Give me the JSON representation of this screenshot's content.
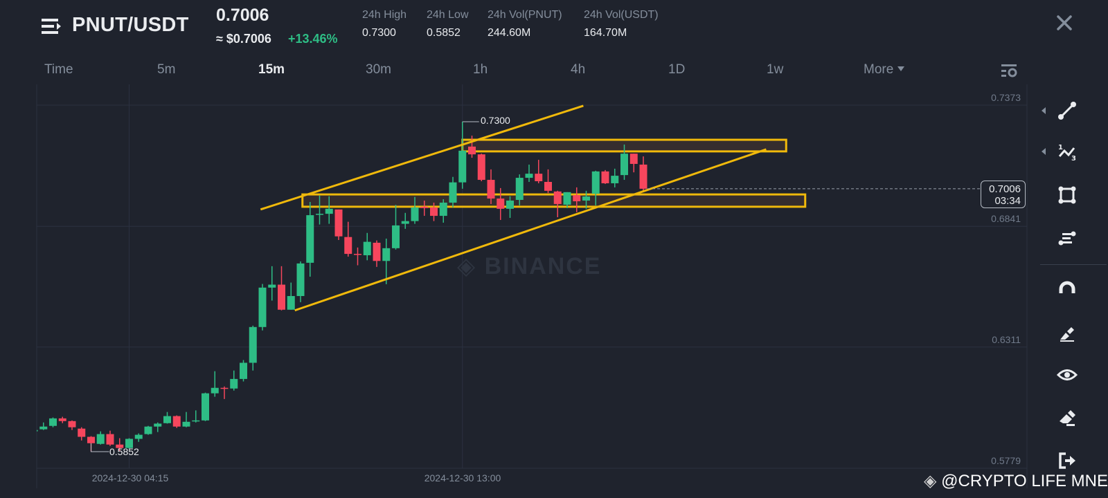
{
  "header": {
    "pair": "PNUT/USDT",
    "last_price": "0.7006",
    "approx_usd": "≈ $0.7006",
    "change_pct": "+13.46%",
    "stats": [
      {
        "label": "24h High",
        "value": "0.7300"
      },
      {
        "label": "24h Low",
        "value": "0.5852"
      },
      {
        "label": "24h Vol(PNUT)",
        "value": "244.60M"
      },
      {
        "label": "24h Vol(USDT)",
        "value": "164.70M"
      }
    ]
  },
  "timeframes": [
    "Time",
    "5m",
    "15m",
    "30m",
    "1h",
    "4h",
    "1D",
    "1w",
    "More"
  ],
  "active_timeframe": "15m",
  "price_tag": {
    "price": "0.7006",
    "countdown": "03:34"
  },
  "watermark": "@CRYPTO LIFE MNE",
  "exchange_watermark": "BINANCE",
  "colors": {
    "up": "#2ebd85",
    "down": "#f6465d",
    "drawing": "#f0b90b",
    "bg": "#1f232d"
  },
  "toolbar": [
    "trend-line",
    "fibonacci",
    "rectangle",
    "horizontal-lines",
    "magnet",
    "brush",
    "eye",
    "eraser",
    "exit"
  ],
  "chart_data": {
    "type": "candlestick",
    "interval": "15m",
    "y_ticks": [
      "0.7373",
      "0.6841",
      "0.6311",
      "0.5779"
    ],
    "ylim": [
      0.5779,
      0.7373
    ],
    "x_ticks": [
      {
        "index": 10,
        "label": "2024-12-30 04:15"
      },
      {
        "index": 45,
        "label": "2024-12-30 13:00"
      }
    ],
    "high_marker": {
      "index": 45,
      "price": 0.73,
      "label": "0.7300"
    },
    "low_marker": {
      "index": 6,
      "price": 0.5852,
      "label": "0.5852"
    },
    "current_price": 0.7006,
    "candles_ohlc": [
      [
        0.5941,
        0.595,
        0.5934,
        0.5947
      ],
      [
        0.595,
        0.598,
        0.5947,
        0.5962
      ],
      [
        0.5965,
        0.6002,
        0.5959,
        0.5998
      ],
      [
        0.5998,
        0.6005,
        0.5977,
        0.5986
      ],
      [
        0.5986,
        0.5989,
        0.5947,
        0.5959
      ],
      [
        0.5953,
        0.5959,
        0.5901,
        0.5917
      ],
      [
        0.5917,
        0.592,
        0.5853,
        0.5889
      ],
      [
        0.5886,
        0.5941,
        0.5883,
        0.5929
      ],
      [
        0.5929,
        0.5944,
        0.5877,
        0.5883
      ],
      [
        0.5883,
        0.5911,
        0.5856,
        0.5868
      ],
      [
        0.5868,
        0.5911,
        0.5865,
        0.5908
      ],
      [
        0.5908,
        0.5932,
        0.5895,
        0.5926
      ],
      [
        0.5929,
        0.5965,
        0.5926,
        0.5962
      ],
      [
        0.5962,
        0.598,
        0.5938,
        0.5975
      ],
      [
        0.5977,
        0.6026,
        0.5975,
        0.6008
      ],
      [
        0.6008,
        0.6011,
        0.5956,
        0.5962
      ],
      [
        0.5962,
        0.6026,
        0.5959,
        0.5983
      ],
      [
        0.5986,
        0.6033,
        0.598,
        0.5989
      ],
      [
        0.5989,
        0.6111,
        0.5986,
        0.6108
      ],
      [
        0.6108,
        0.6205,
        0.6093,
        0.6132
      ],
      [
        0.6132,
        0.6138,
        0.6083,
        0.6129
      ],
      [
        0.6129,
        0.6208,
        0.612,
        0.6171
      ],
      [
        0.6171,
        0.6254,
        0.616,
        0.6242
      ],
      [
        0.6242,
        0.6405,
        0.6208,
        0.6399
      ],
      [
        0.6399,
        0.6588,
        0.6384,
        0.6572
      ],
      [
        0.6572,
        0.6666,
        0.6515,
        0.6585
      ],
      [
        0.6585,
        0.6666,
        0.6472,
        0.6475
      ],
      [
        0.6475,
        0.6594,
        0.6475,
        0.6535
      ],
      [
        0.6535,
        0.6687,
        0.6508,
        0.6678
      ],
      [
        0.6681,
        0.6948,
        0.662,
        0.689
      ],
      [
        0.6893,
        0.6976,
        0.6849,
        0.6896
      ],
      [
        0.6896,
        0.6973,
        0.6852,
        0.6918
      ],
      [
        0.6915,
        0.6915,
        0.6781,
        0.6797
      ],
      [
        0.6794,
        0.6861,
        0.6708,
        0.672
      ],
      [
        0.672,
        0.6748,
        0.667,
        0.6717
      ],
      [
        0.6714,
        0.6812,
        0.6692,
        0.6773
      ],
      [
        0.6769,
        0.6779,
        0.6663,
        0.6689
      ],
      [
        0.6689,
        0.6787,
        0.6587,
        0.6745
      ],
      [
        0.6745,
        0.6935,
        0.6739,
        0.6845
      ],
      [
        0.6852,
        0.69,
        0.683,
        0.6864
      ],
      [
        0.6864,
        0.697,
        0.6852,
        0.6924
      ],
      [
        0.6927,
        0.6954,
        0.6887,
        0.6921
      ],
      [
        0.6924,
        0.6945,
        0.6864,
        0.6887
      ],
      [
        0.6887,
        0.696,
        0.6857,
        0.6945
      ],
      [
        0.6945,
        0.7058,
        0.6924,
        0.7034
      ],
      [
        0.7034,
        0.73,
        0.7006,
        0.7173
      ],
      [
        0.7191,
        0.7239,
        0.7142,
        0.7157
      ],
      [
        0.7157,
        0.716,
        0.7039,
        0.7045
      ],
      [
        0.7045,
        0.7091,
        0.6939,
        0.6963
      ],
      [
        0.6963,
        0.7009,
        0.6869,
        0.6918
      ],
      [
        0.6918,
        0.6973,
        0.6878,
        0.6954
      ],
      [
        0.6957,
        0.7069,
        0.6933,
        0.7054
      ],
      [
        0.7054,
        0.7112,
        0.7036,
        0.7072
      ],
      [
        0.7072,
        0.7133,
        0.703,
        0.7039
      ],
      [
        0.7036,
        0.7091,
        0.6987,
        0.6997
      ],
      [
        0.6994,
        0.6997,
        0.6881,
        0.6939
      ],
      [
        0.6936,
        0.6991,
        0.6921,
        0.6991
      ],
      [
        0.6978,
        0.7012,
        0.6903,
        0.6951
      ],
      [
        0.6954,
        0.6997,
        0.6918,
        0.6972
      ],
      [
        0.6984,
        0.7085,
        0.6933,
        0.7082
      ],
      [
        0.7082,
        0.7088,
        0.7027,
        0.703
      ],
      [
        0.703,
        0.7094,
        0.7012,
        0.7063
      ],
      [
        0.7066,
        0.72,
        0.7045,
        0.716
      ],
      [
        0.716,
        0.716,
        0.7078,
        0.7115
      ],
      [
        0.7112,
        0.7148,
        0.6998,
        0.7006
      ]
    ],
    "drawings": {
      "channel_upper": {
        "from": [
          23.8,
          0.6915
        ],
        "to": [
          57.7,
          0.737
        ]
      },
      "channel_lower": {
        "from": [
          27.4,
          0.6472
        ],
        "to": [
          76.9,
          0.7179
        ]
      },
      "resistance_box": {
        "from_index": 45,
        "to_index": 79,
        "top": 0.7221,
        "bottom": 0.717
      },
      "support_box": {
        "from_index": 28.2,
        "to_index": 81,
        "top": 0.6981,
        "bottom": 0.6927
      }
    }
  }
}
